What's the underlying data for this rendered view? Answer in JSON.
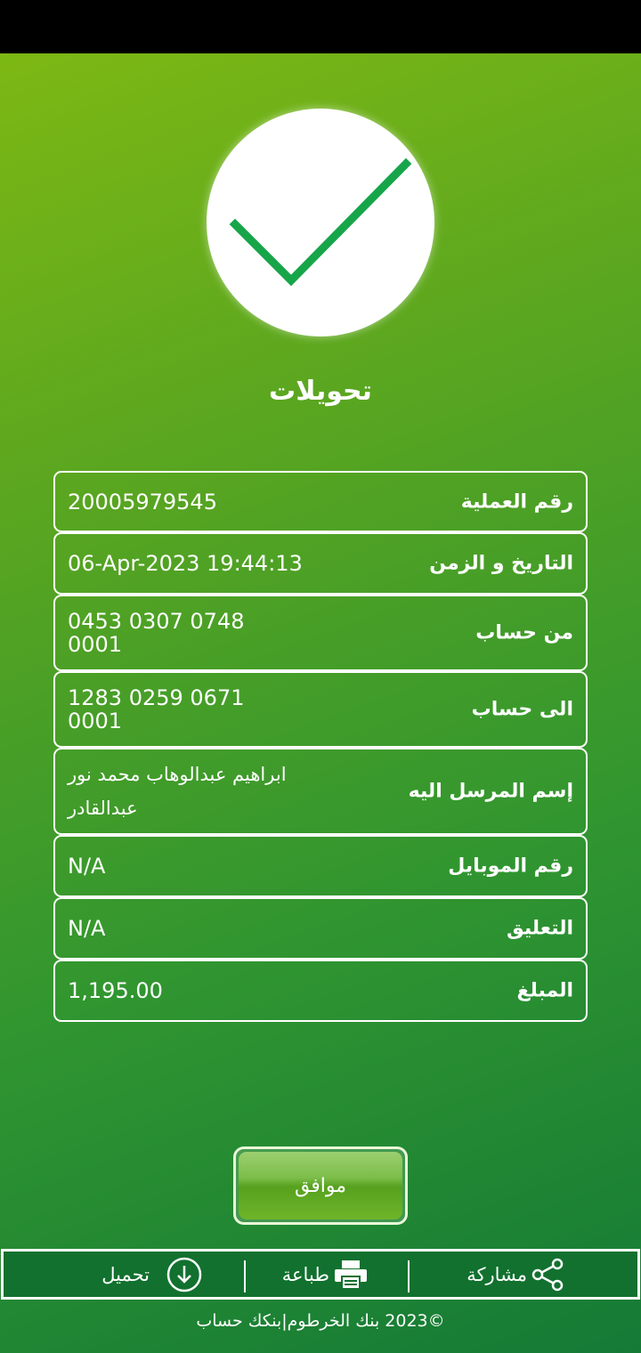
{
  "title": "تحويلات",
  "details": [
    {
      "label": "رقم العملية",
      "value": "20005979545"
    },
    {
      "label": "التاريخ و الزمن",
      "value": "06-Apr-2023 19:44:13"
    },
    {
      "label": "من حساب",
      "value": "0453 0307 0748 0001"
    },
    {
      "label": "الى حساب",
      "value": "1283 0259 0671 0001"
    },
    {
      "label": "إسم المرسل اليه",
      "value": "ابراهيم عبدالوهاب محمد نور عبدالقادر"
    },
    {
      "label": "رقم الموبايل",
      "value": "N/A"
    },
    {
      "label": "التعليق",
      "value": "N/A"
    },
    {
      "label": "المبلغ",
      "value": "1,195.00"
    }
  ],
  "ok_label": "موافق",
  "actions": {
    "share": "مشاركة",
    "print": "طباعة",
    "download": "تحميل"
  },
  "footer": "©2023 بنك الخرطوم|بنكك حساب",
  "colors": {
    "checkmark": "#17a54a",
    "gradient_top": "#7db814",
    "gradient_bottom": "#147a36"
  }
}
